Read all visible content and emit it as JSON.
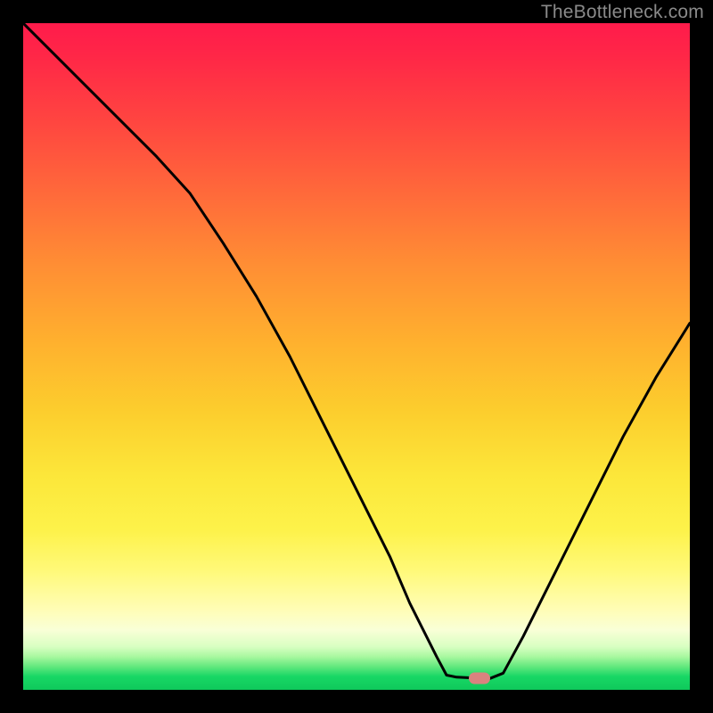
{
  "watermark": "TheBottleneck.com",
  "marker": {
    "x_pct": 68.5,
    "y_pct": 98.3
  },
  "curve_points": [
    {
      "x": 0,
      "y": 0
    },
    {
      "x": 10,
      "y": 10
    },
    {
      "x": 20,
      "y": 20
    },
    {
      "x": 25,
      "y": 25.5
    },
    {
      "x": 30,
      "y": 33
    },
    {
      "x": 35,
      "y": 41
    },
    {
      "x": 40,
      "y": 50
    },
    {
      "x": 45,
      "y": 60
    },
    {
      "x": 50,
      "y": 70
    },
    {
      "x": 55,
      "y": 80
    },
    {
      "x": 58,
      "y": 87
    },
    {
      "x": 60,
      "y": 91
    },
    {
      "x": 62,
      "y": 95
    },
    {
      "x": 63.5,
      "y": 97.8
    },
    {
      "x": 65,
      "y": 98.1
    },
    {
      "x": 67,
      "y": 98.2
    },
    {
      "x": 70,
      "y": 98.3
    },
    {
      "x": 72,
      "y": 97.5
    },
    {
      "x": 75,
      "y": 92
    },
    {
      "x": 80,
      "y": 82
    },
    {
      "x": 85,
      "y": 72
    },
    {
      "x": 90,
      "y": 62
    },
    {
      "x": 95,
      "y": 53
    },
    {
      "x": 100,
      "y": 45
    }
  ],
  "chart_data": {
    "type": "line",
    "title": "",
    "xlabel": "",
    "ylabel": "",
    "xlim": [
      0,
      100
    ],
    "ylim": [
      0,
      100
    ],
    "grid": false,
    "legend": false,
    "background": "rainbow-gradient",
    "series": [
      {
        "name": "curve",
        "x": [
          0,
          10,
          20,
          25,
          30,
          35,
          40,
          45,
          50,
          55,
          58,
          60,
          62,
          63.5,
          65,
          67,
          70,
          72,
          75,
          80,
          85,
          90,
          95,
          100
        ],
        "y": [
          100,
          90,
          80,
          74.5,
          67,
          59,
          50,
          40,
          30,
          20,
          13,
          9,
          5,
          2.2,
          1.9,
          1.8,
          1.7,
          2.5,
          8,
          18,
          28,
          38,
          47,
          55
        ],
        "color": "#000000"
      }
    ],
    "annotations": [
      {
        "type": "marker",
        "x": 68.5,
        "y": 1.7,
        "shape": "pill",
        "color": "#d9827f"
      }
    ]
  }
}
